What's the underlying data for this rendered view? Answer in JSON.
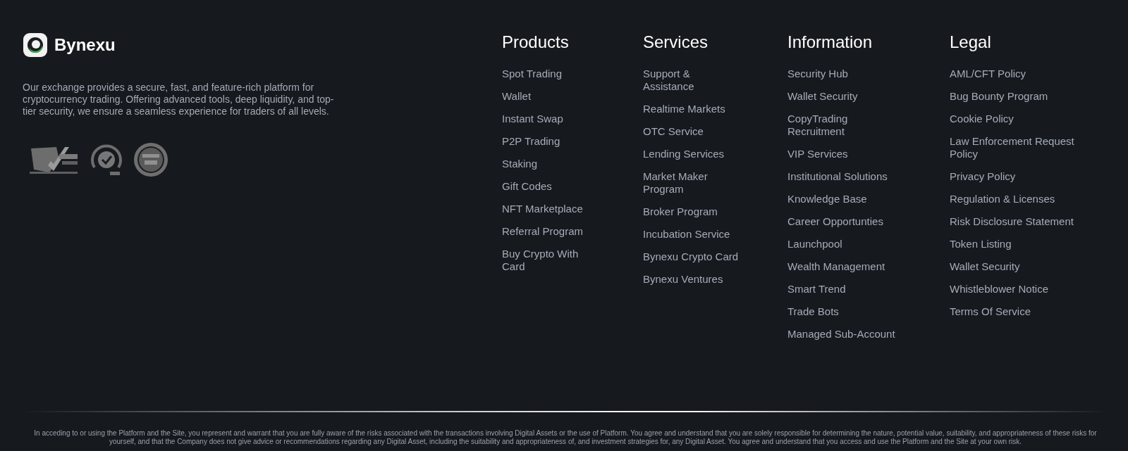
{
  "brand": {
    "name": "Bynexu",
    "description": "Our exchange provides a secure, fast, and feature-rich platform for cryptocurrency trading. Offering advanced tools, deep liquidity, and top-tier security, we ensure a seamless experience for traders of all levels."
  },
  "columns": [
    {
      "title": "Products",
      "links": [
        "Spot Trading",
        "Wallet",
        "Instant Swap",
        "P2P Trading",
        "Staking",
        "Gift Codes",
        "NFT Marketplace",
        "Referral Program",
        "Buy Crypto With Card"
      ]
    },
    {
      "title": "Services",
      "links": [
        "Support & Assistance",
        "Realtime Markets",
        "OTC Service",
        "Lending Services",
        "Market Maker Program",
        "Broker Program",
        "Incubation Service",
        "Bynexu Crypto Card",
        "Bynexu Ventures"
      ]
    },
    {
      "title": "Information",
      "links": [
        "Security Hub",
        "Wallet Security",
        "CopyTrading Recruitment",
        "VIP Services",
        "Institutional Solutions",
        "Knowledge Base",
        "Career Opportunties",
        "Launchpool",
        "Wealth Management",
        "Smart Trend",
        "Trade Bots",
        "Managed Sub-Account"
      ]
    },
    {
      "title": "Legal",
      "links": [
        "AML/CFT Policy",
        "Bug Bounty Program",
        "Cookie Policy",
        "Law Enforcement Request Policy",
        "Privacy Policy",
        "Regulation & Licenses",
        "Risk Disclosure Statement",
        "Token Listing",
        "Wallet Security",
        "Whistleblower Notice",
        "Terms Of Service"
      ]
    }
  ],
  "disclaimer": "In acceding to or using the Platform and the Site, you represent and warrant that you are fully aware of the risks associated with the transactions involving Digital Assets or the use of Platform. You agree and understand that you are solely responsible for determining the nature, potential value, suitability, and appropriateness of these risks for yourself, and that the Company does not give advice or recommendations regarding any Digital Asset, including the suitability and appropriateness of, and investment strategies for, any Digital Asset. You agree and understand that you access and use the Platform and the Site at your own risk."
}
